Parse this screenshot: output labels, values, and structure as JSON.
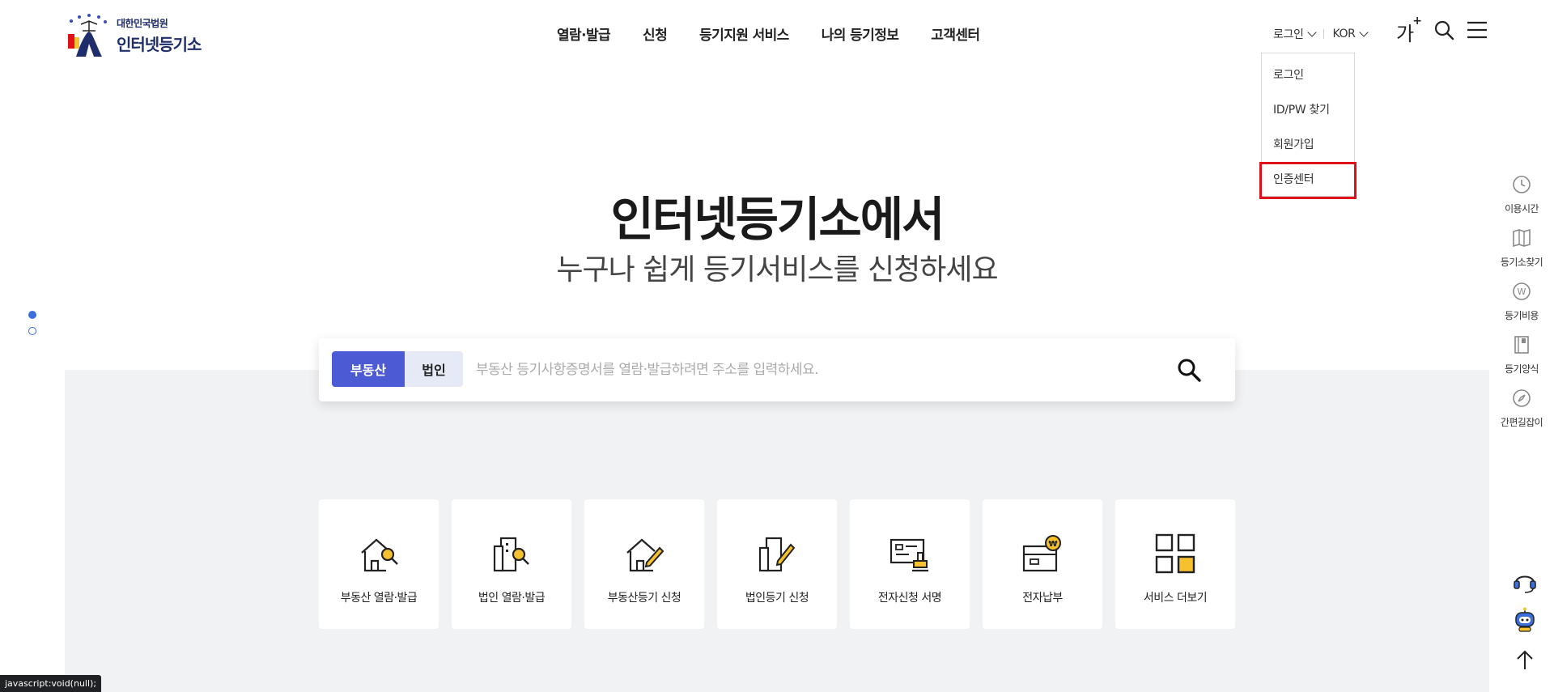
{
  "logo": {
    "org": "대한민국법원",
    "name": "인터넷등기소"
  },
  "nav": [
    "열람·발급",
    "신청",
    "등기지원 서비스",
    "나의 등기정보",
    "고객센터"
  ],
  "util": {
    "login_label": "로그인",
    "lang_label": "KOR",
    "font_size_label": "가",
    "font_size_plus": "+"
  },
  "login_menu": [
    "로그인",
    "ID/PW 찾기",
    "회원가입",
    "인증센터"
  ],
  "hero": {
    "title": "인터넷등기소에서",
    "subtitle": "누구나 쉽게 등기서비스를 신청하세요"
  },
  "search": {
    "tabs": [
      "부동산",
      "법인"
    ],
    "active_tab": "부동산",
    "placeholder": "부동산 등기사항증명서를 열람·발급하려면 주소를 입력하세요.",
    "value": ""
  },
  "services": [
    {
      "label": "부동산 열람·발급",
      "icon": "house-search-icon"
    },
    {
      "label": "법인 열람·발급",
      "icon": "building-search-icon"
    },
    {
      "label": "부동산등기 신청",
      "icon": "house-pen-icon"
    },
    {
      "label": "법인등기 신청",
      "icon": "building-pen-icon"
    },
    {
      "label": "전자신청 서명",
      "icon": "document-stamp-icon"
    },
    {
      "label": "전자납부",
      "icon": "wallet-won-icon"
    },
    {
      "label": "서비스 더보기",
      "icon": "grid-icon"
    }
  ],
  "quick_menu": [
    {
      "label": "이용시간",
      "icon": "clock-icon"
    },
    {
      "label": "등기소찾기",
      "icon": "map-icon"
    },
    {
      "label": "등기비용",
      "icon": "won-coin-icon"
    },
    {
      "label": "등기양식",
      "icon": "form-book-icon"
    },
    {
      "label": "간편길잡이",
      "icon": "compass-icon"
    }
  ],
  "status_bar": "javascript:void(null);",
  "colors": {
    "accent": "#4c5bd4",
    "highlight": "#e0111a",
    "icon_yellow": "#f5c12e",
    "dot_blue": "#3b6fdc"
  }
}
